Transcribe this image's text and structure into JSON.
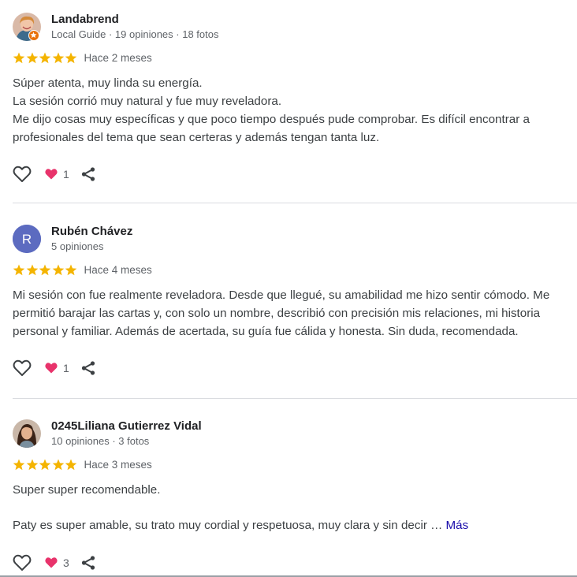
{
  "reviews": [
    {
      "name": "Landabrend",
      "meta": "Local Guide · 19 opiniones · 18 fotos",
      "rating": 5,
      "date": "Hace 2 meses",
      "lines": [
        "Súper atenta, muy linda su energía.",
        "La sesión corrió muy natural y fue muy reveladora.",
        "Me dijo cosas muy específicas y que poco tiempo después pude comprobar. Es difícil encontrar a",
        "profesionales del tema que sean certeras y además tengan tanta luz."
      ],
      "reactions": "1",
      "avatar": "profile-photo"
    },
    {
      "name": "Rubén Chávez",
      "meta": "5 opiniones",
      "rating": 5,
      "date": "Hace 4 meses",
      "lines": [
        "Mi sesión con fue realmente reveladora. Desde que llegué, su amabilidad me hizo sentir cómodo. Me",
        "permitió barajar las cartas y, con solo un nombre, describió con precisión mis relaciones, mi historia",
        "personal y familiar. Además de acertada, su guía fue cálida y honesta. Sin duda, recomendada."
      ],
      "reactions": "1",
      "avatar_letter": "R",
      "avatar_color": "#5c6bc0"
    },
    {
      "name": "0245Liliana Gutierrez Vidal",
      "meta": "10 opiniones · 3 fotos",
      "rating": 5,
      "date": "Hace 3 meses",
      "line1": "Super super recomendable.",
      "line2": "Paty es super amable, su trato muy cordial y respetuosa, muy clara y sin decir …",
      "more_label": "Más",
      "reactions": "3",
      "avatar": "profile-photo"
    }
  ],
  "colors": {
    "star": "#f4b400",
    "heart": "#e8336b",
    "link": "#1a0dab",
    "guide_badge": "#e8710a"
  },
  "icons": [
    "heart-outline-icon",
    "heart-filled-icon",
    "share-icon",
    "star-icon",
    "local-guide-badge-icon"
  ]
}
